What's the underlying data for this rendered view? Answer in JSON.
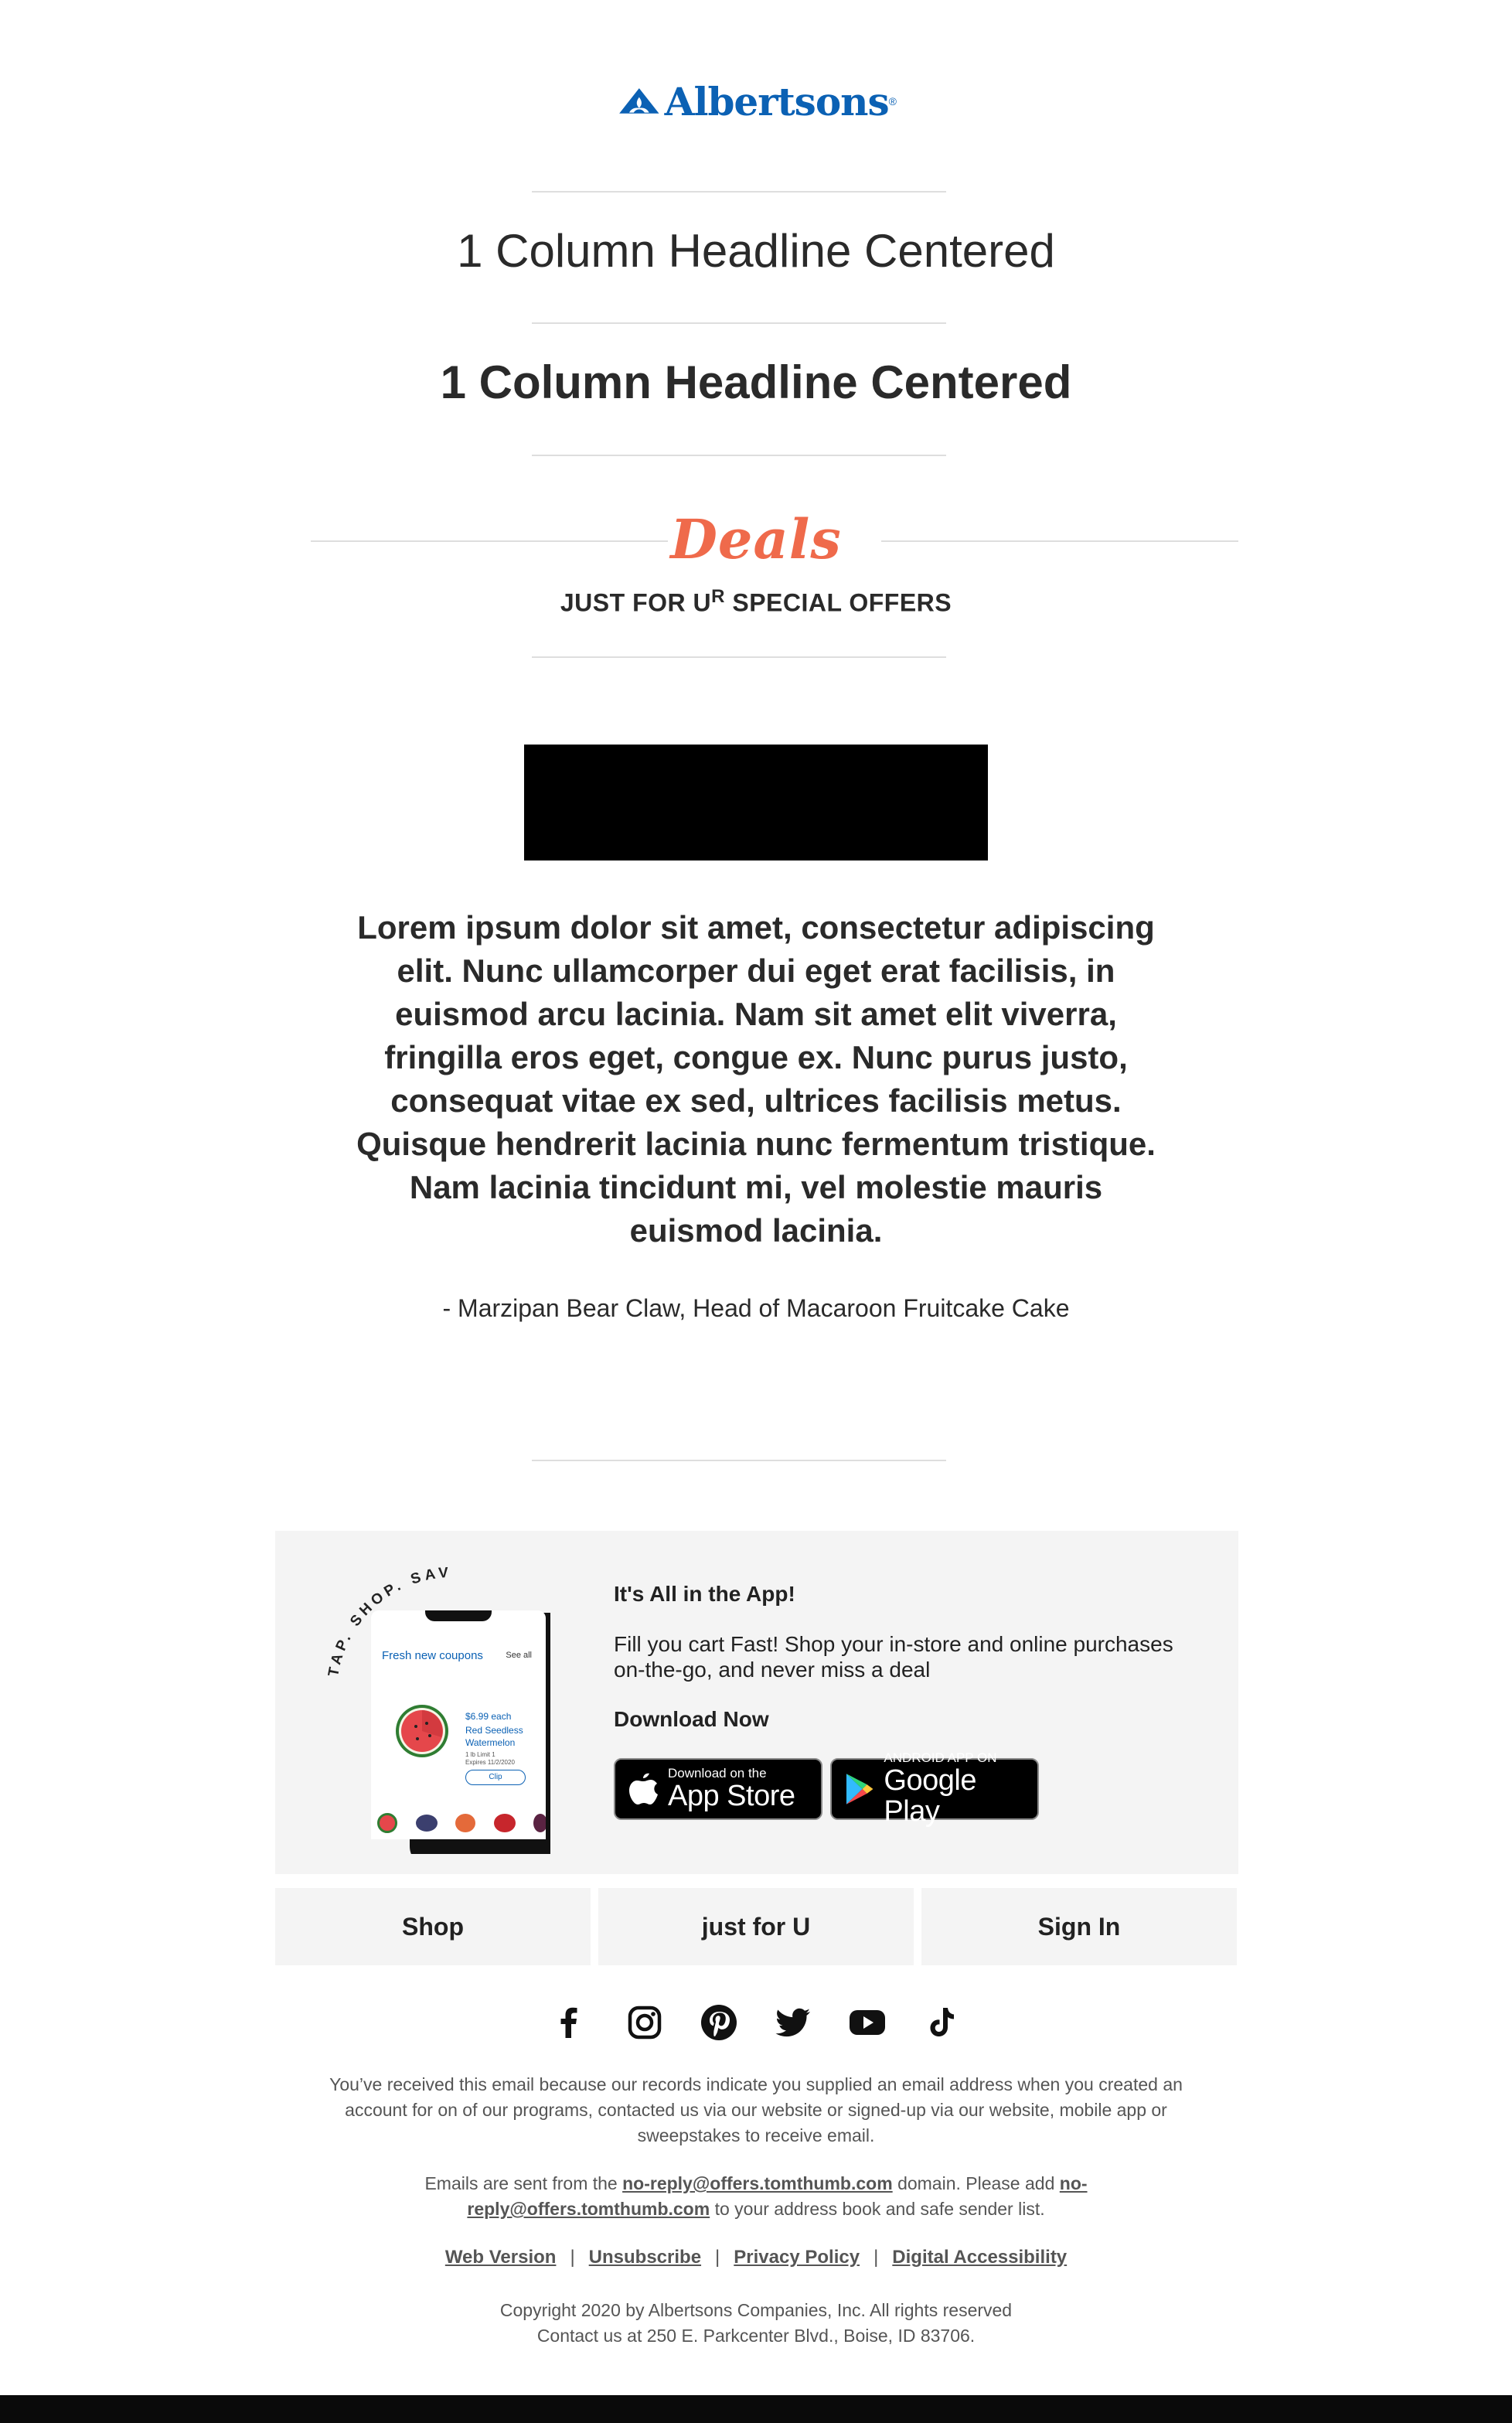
{
  "brand": {
    "name": "Albertsons",
    "registered": "®",
    "color": "#0b61b4"
  },
  "headlines": {
    "light": "1 Column Headline Centered",
    "bold": "1 Column Headline Centered"
  },
  "deals": {
    "word": "Deals",
    "sub_prefix": "JUST FOR U",
    "sub_sup": "R",
    "sub_suffix": " SPECIAL OFFERS",
    "accent": "#ef6a4b"
  },
  "quote": {
    "text": "Lorem ipsum dolor sit amet, consectetur adipiscing elit. Nunc ullamcorper dui eget erat facilisis, in euismod arcu lacinia. Nam sit amet elit viverra, fringilla eros eget, congue ex. Nunc purus justo, consequat vitae ex sed, ultrices facilisis metus. Quisque hendrerit lacinia nunc fermentum tristique. Nam lacinia tincidunt mi, vel molestie mauris euismod lacinia.",
    "attribution": "- Marzipan Bear Claw, Head of Macaroon Fruitcake Cake"
  },
  "app_promo": {
    "arc_text": "TAP. SHOP. SAVE.",
    "phone": {
      "header": "Fresh new coupons",
      "see_all": "See all",
      "price": "$6.99 each",
      "product_line1": "Red Seedless",
      "product_line2": "Watermelon",
      "product_meta": "1 lb Limit 1",
      "expires": "Expires 11/2/2020",
      "clip": "Clip"
    },
    "title": "It's All in the App!",
    "body": "Fill you cart Fast! Shop your in-store and online purchases on-the-go, and never miss a deal",
    "download": "Download Now",
    "app_store": {
      "small": "Download on the",
      "big": "App Store"
    },
    "google_play": {
      "small": "ANDROID APP ON",
      "big": "Google Play"
    }
  },
  "nav": [
    {
      "label": "Shop"
    },
    {
      "label": "just for U"
    },
    {
      "label": "Sign In"
    }
  ],
  "social": [
    "facebook-icon",
    "instagram-icon",
    "pinterest-icon",
    "twitter-icon",
    "youtube-icon",
    "tiktok-icon"
  ],
  "footer": {
    "notice": "You’ve received this email because our records indicate you supplied an email address when you created an account for on of our programs, contacted us via our website or signed-up via our website, mobile app or sweepstakes to receive email.",
    "emails_prefix": "Emails are sent from the ",
    "sender": "no-reply@offers.tomthumb.com",
    "emails_mid": " domain. Please add ",
    "emails_suffix": " to your address book and safe sender list.",
    "links": [
      "Web Version",
      "Unsubscribe",
      "Privacy Policy",
      "Digital Accessibility"
    ],
    "separator": "|",
    "copyright": "Copyright 2020 by Albertsons Companies, Inc. All rights reserved",
    "contact": "Contact us at 250 E. Parkcenter Blvd., Boise, ID 83706."
  }
}
